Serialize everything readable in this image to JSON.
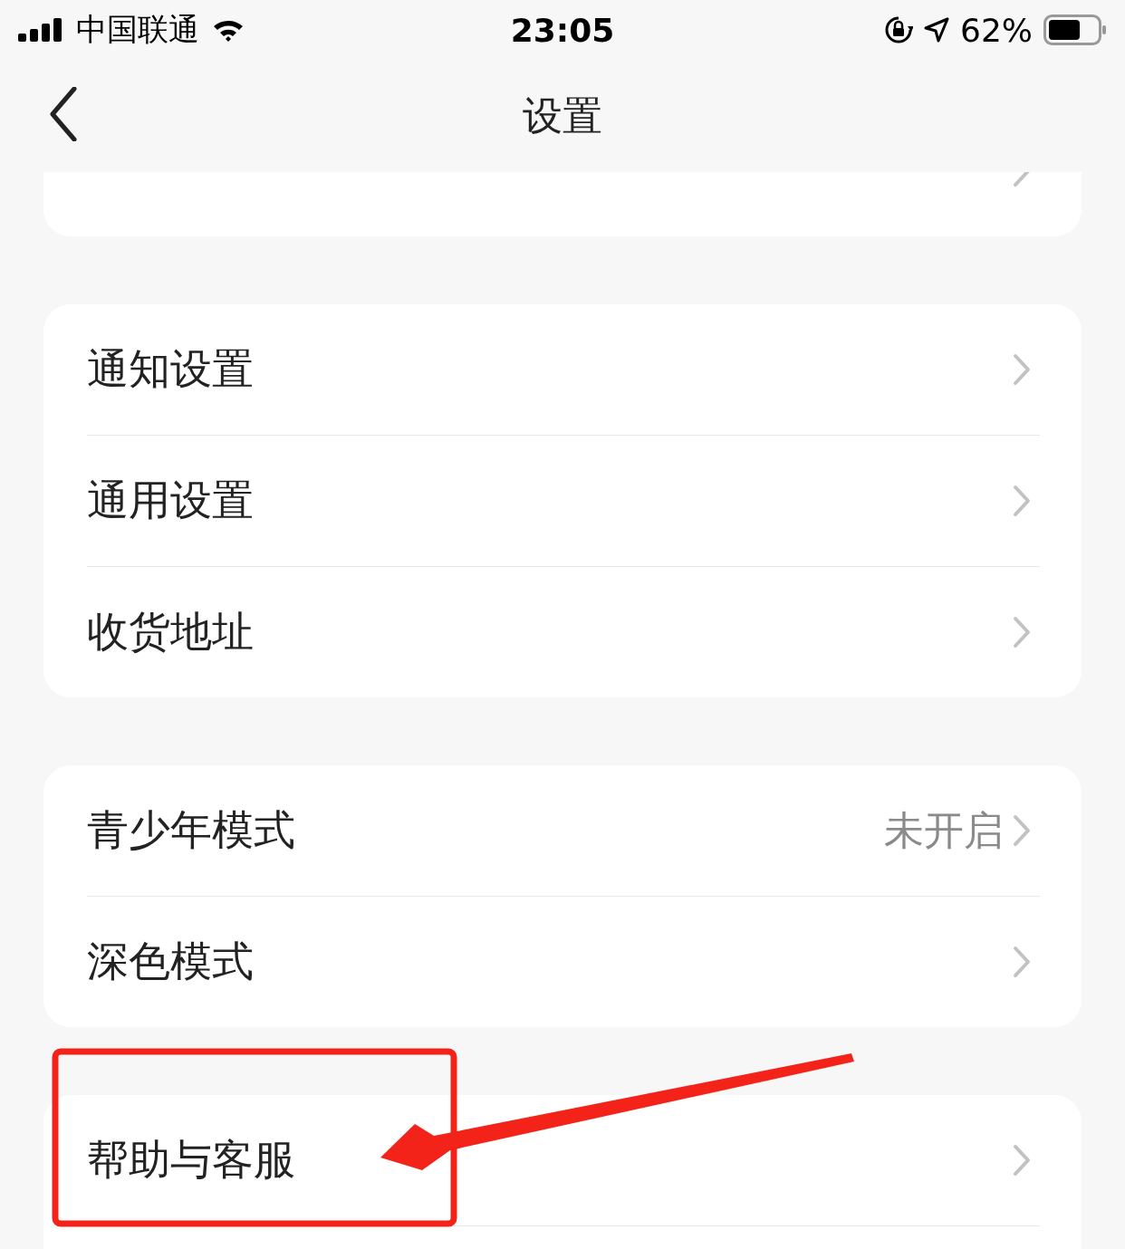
{
  "status_bar": {
    "carrier": "中国联通",
    "time": "23:05",
    "battery_percent": "62%"
  },
  "nav_bar": {
    "title": "设置"
  },
  "sections": [
    {
      "rows": [
        {
          "chevron": true
        }
      ]
    },
    {
      "rows": [
        {
          "label": "通知设置"
        },
        {
          "label": "通用设置"
        },
        {
          "label": "收货地址"
        }
      ]
    },
    {
      "rows": [
        {
          "label": "青少年模式",
          "value": "未开启"
        },
        {
          "label": "深色模式"
        }
      ]
    },
    {
      "rows": [
        {
          "label": "帮助与客服"
        }
      ],
      "continues": true
    }
  ]
}
